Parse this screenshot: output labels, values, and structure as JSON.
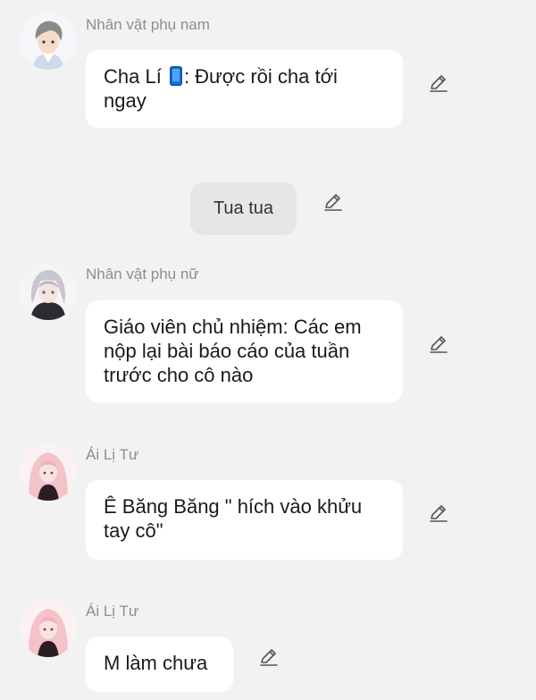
{
  "messages": [
    {
      "sender": "Nhân vật phụ nam",
      "text_before": "Cha Lí ",
      "icon": "mobile-phone-emoji",
      "text_after": ": Được rồi cha tới ngay"
    },
    {
      "sender": "Nhân vật phụ nữ",
      "text": "Giáo viên chủ nhiệm: Các em nộp lại bài báo cáo của tuần trước cho cô nào"
    },
    {
      "sender": "Ái Lị Tư",
      "text": "Ê Băng Băng \" hích vào khửu tay cô\""
    },
    {
      "sender": "Ái Lị Tư",
      "text": "M làm chưa"
    }
  ],
  "narration": {
    "text": "Tua tua"
  },
  "icons": {
    "edit": "pencil-edit-icon",
    "accent": "#1e6fd9"
  }
}
